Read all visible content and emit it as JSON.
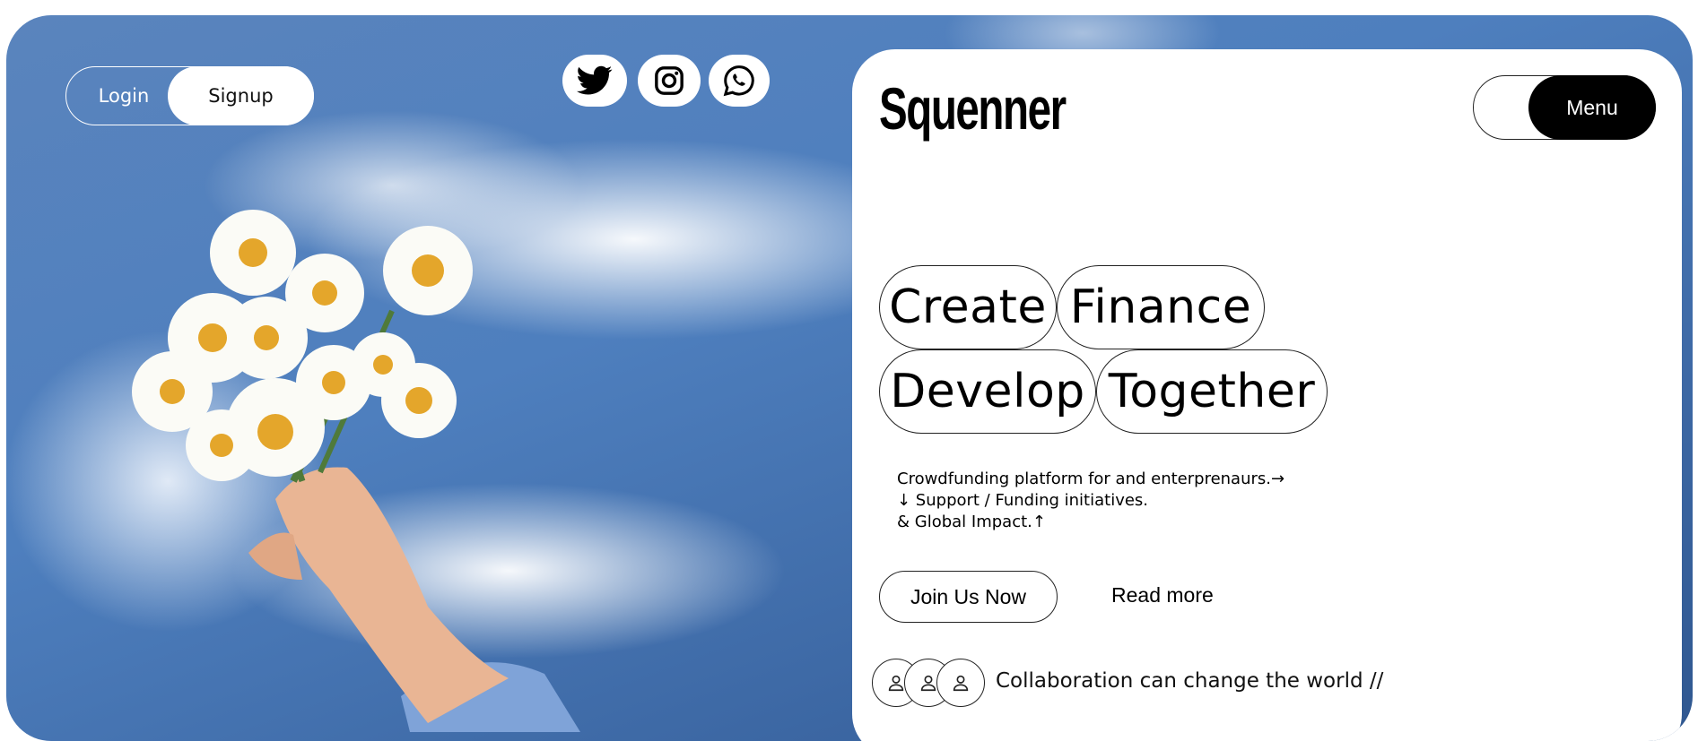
{
  "auth": {
    "login_label": "Login",
    "signup_label": "Signup"
  },
  "social": [
    {
      "icon": "twitter-icon"
    },
    {
      "icon": "instagram-icon"
    },
    {
      "icon": "whatsapp-icon"
    }
  ],
  "brand": {
    "name": "Squenner"
  },
  "menu": {
    "label": "Menu"
  },
  "headline": {
    "words": [
      "Create",
      "Finance",
      "Develop",
      "Together"
    ]
  },
  "description": {
    "line1": "Crowdfunding platform for and enterprenaurs.→",
    "line2": "↓ Support / Funding initiatives.",
    "line3": "& Global Impact.↑"
  },
  "cta": {
    "join_label": "Join Us Now",
    "read_more_label": "Read more"
  },
  "collaboration": {
    "text": "Collaboration can change the world //"
  },
  "colors": {
    "sky": "#4e7fbe",
    "card": "#ffffff",
    "accent": "#000000"
  }
}
